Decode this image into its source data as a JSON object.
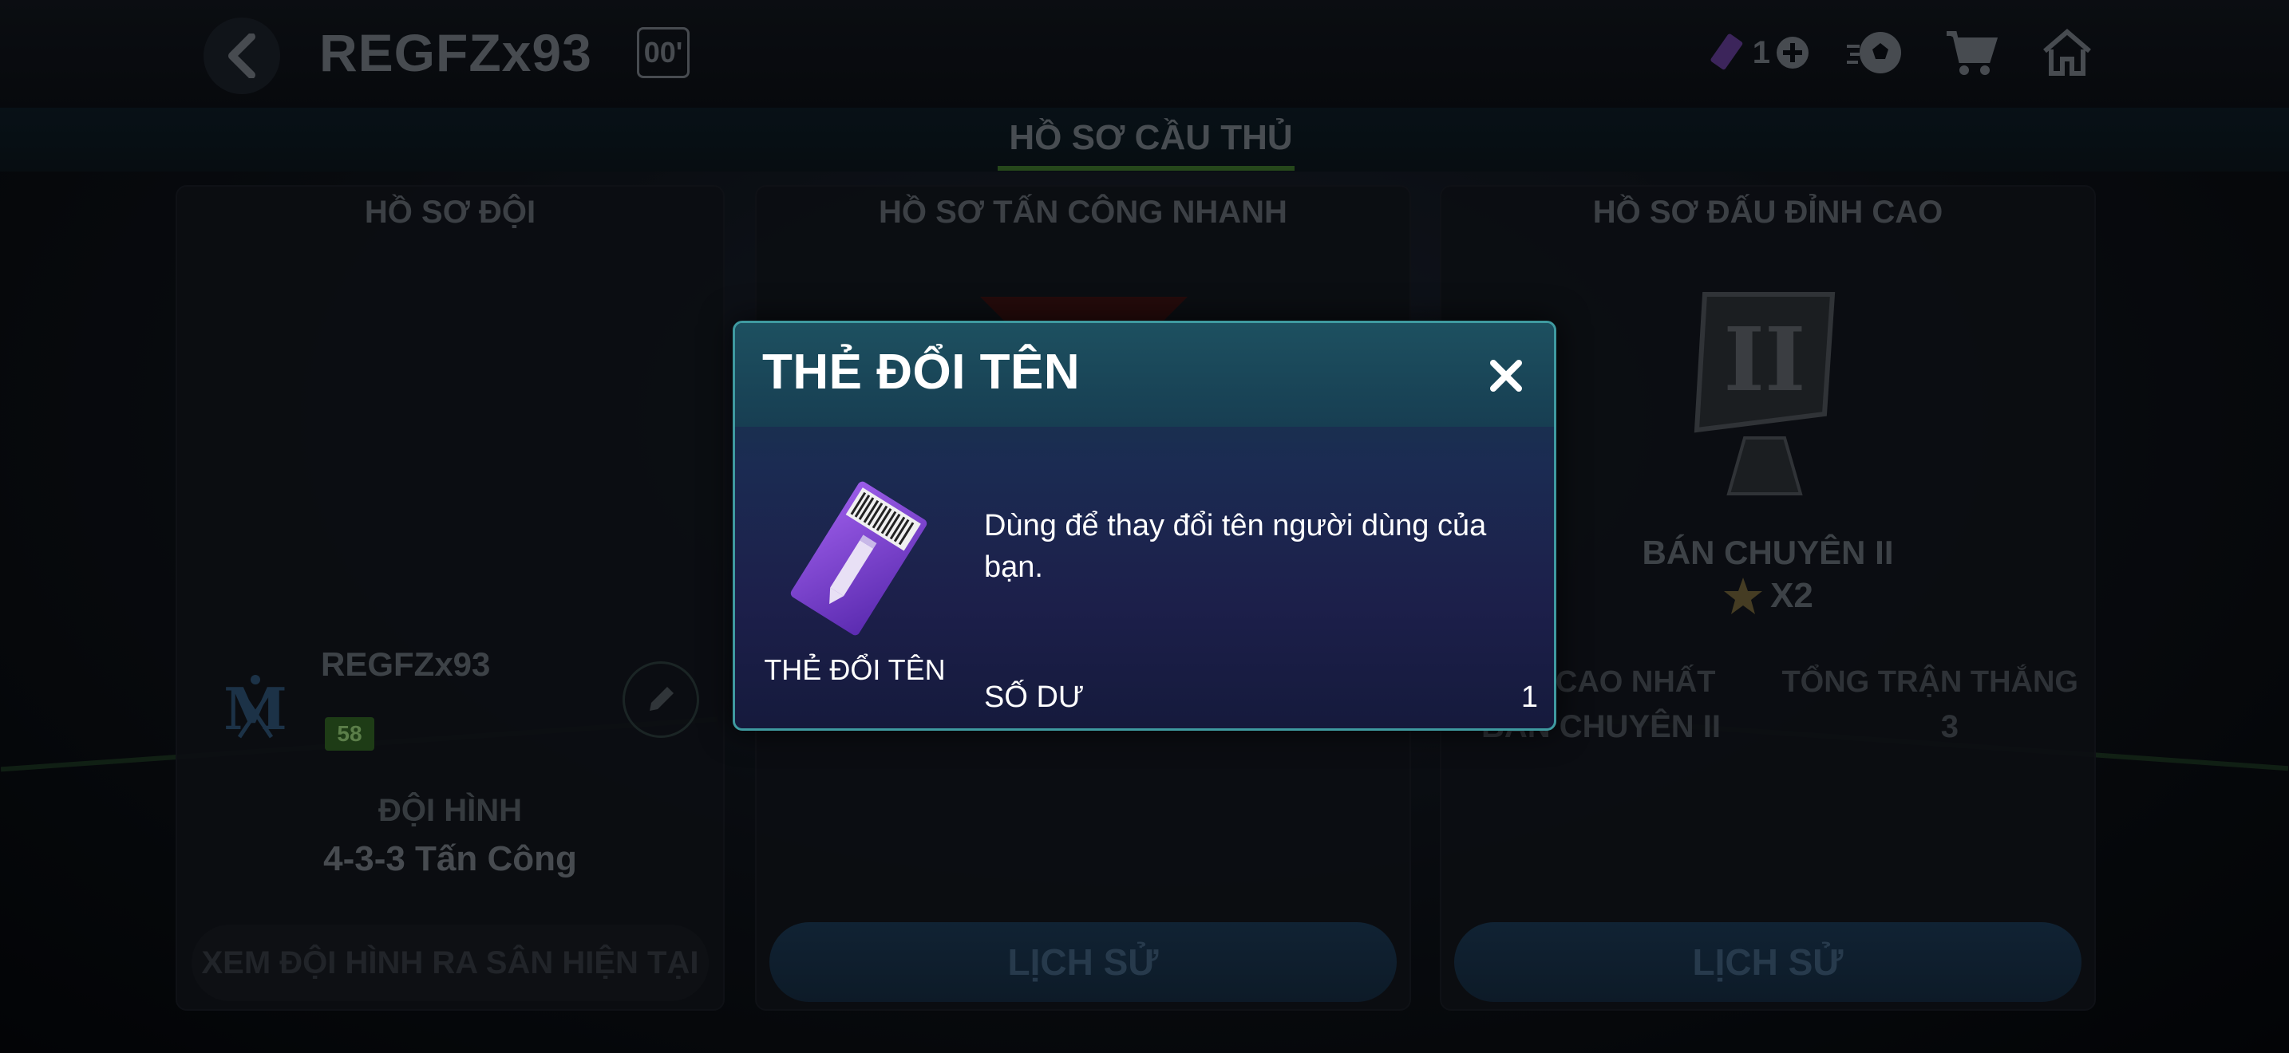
{
  "topbar": {
    "profile_name": "REGFZx93",
    "level_badge": "00'",
    "ticket_count": "1"
  },
  "section": {
    "title": "HỒ SƠ CẦU THỦ"
  },
  "team_card": {
    "title": "HỒ SƠ ĐỘI",
    "team_name": "REGFZx93",
    "team_level": "58",
    "formation_label": "ĐỘI HÌNH",
    "formation_value": "4-3-3 Tấn Công",
    "view_lineup_label": "XEM ĐỘI HÌNH RA SÂN HIỆN TẠI"
  },
  "quick_attack_card": {
    "title": "HỒ SƠ TẤN CÔNG NHANH",
    "history_label": "LỊCH SỬ"
  },
  "elite_card": {
    "title": "HỒ SƠ ĐẤU ĐỈNH CAO",
    "rank_name": "BÁN CHUYÊN II",
    "rank_multiplier": "X2",
    "stat_labels": [
      "ĐẤU CAO NHẤT",
      "TỔNG TRẬN THẮNG"
    ],
    "stat_values": [
      "BÁN CHUYÊN II",
      "3"
    ],
    "history_label": "LỊCH SỬ"
  },
  "modal": {
    "title": "THẺ ĐỔI TÊN",
    "item_name": "THẺ ĐỔI TÊN",
    "description": "Dùng để thay đổi tên người dùng của bạn.",
    "balance_label": "SỐ DƯ",
    "balance_value": "1"
  },
  "colors": {
    "modal_border": "#3f9aa0",
    "accent_green": "#3b6e2a",
    "ticket_purple": "#7b3fd0"
  },
  "icons": [
    "back-icon",
    "ticket-icon",
    "add-icon",
    "football-icon",
    "cart-icon",
    "home-icon",
    "edit-icon",
    "close-icon",
    "star-icon"
  ]
}
